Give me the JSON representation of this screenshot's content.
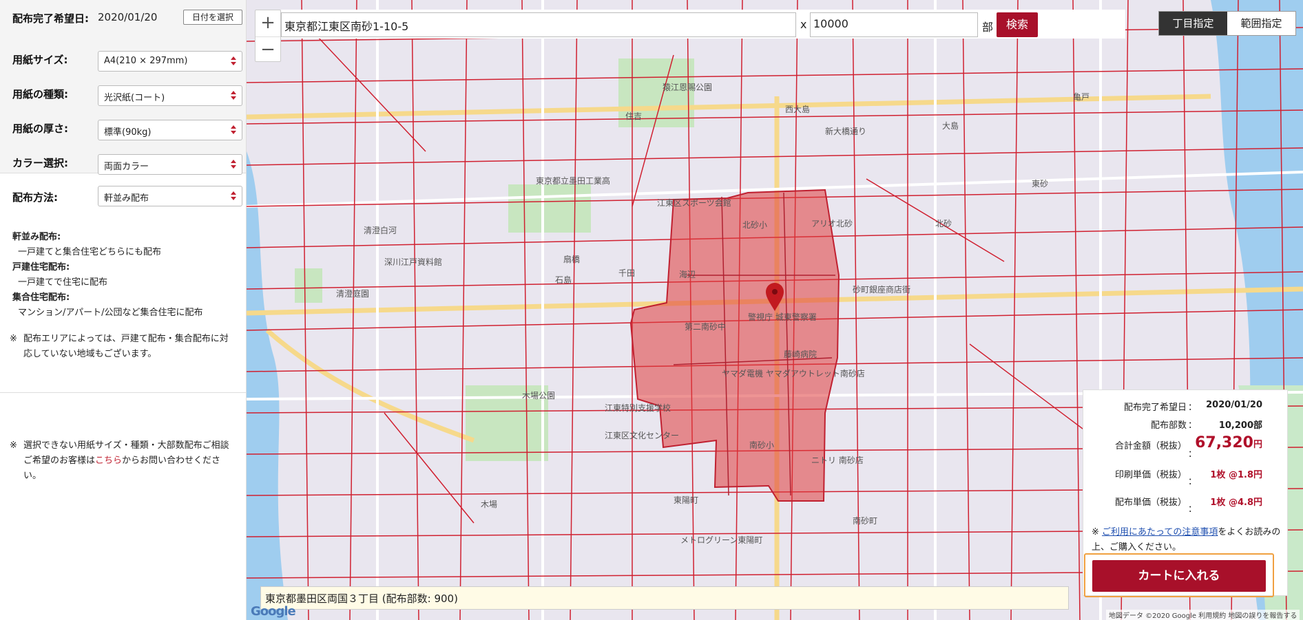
{
  "left_panel": {
    "delivery_date": {
      "label": "配布完了希望日:",
      "value": "2020/01/20",
      "button": "日付を選択"
    },
    "paper_size": {
      "label": "用紙サイズ:",
      "value": "A4(210 × 297mm)"
    },
    "paper_type": {
      "label": "用紙の種類:",
      "value": "光沢紙(コート)"
    },
    "paper_thickness": {
      "label": "用紙の厚さ:",
      "value": "標準(90kg)"
    },
    "color": {
      "label": "カラー選択:",
      "value": "両面カラー"
    },
    "method": {
      "label": "配布方法:",
      "value": "軒並み配布"
    },
    "notes": [
      {
        "title": "軒並み配布:",
        "desc": "一戸建てと集合住宅どちらにも配布"
      },
      {
        "title": "戸建住宅配布:",
        "desc": "一戸建てで住宅に配布"
      },
      {
        "title": "集合住宅配布:",
        "desc": "マンション/アパート/公団など集合住宅に配布"
      }
    ],
    "caution1": {
      "mark": "※",
      "text": "配布エリアによっては、戸建て配布・集合配布に対応していない地域もございます。"
    },
    "caution2": {
      "mark": "※",
      "text_before": "選択できない用紙サイズ・種類・大部数配布ご相談ご希望のお客様は",
      "link": "こちら",
      "text_after": "からお問い合わせください。"
    }
  },
  "map": {
    "zoom_in": "+",
    "zoom_out": "−",
    "address": "東京都江東区南砂1-10-5",
    "times": "x",
    "quantity": "10000",
    "unit": "部",
    "search_button": "検索",
    "mode_town": "丁目指定",
    "mode_range": "範囲指定",
    "area_status": "東京都墨田区両国３丁目 (配布部数: 900)",
    "google": "Google",
    "copyright": "地図データ ©2020 Google   利用規約   地図の誤りを報告する",
    "labels": [
      "北砂小",
      "アリオ北砂",
      "海辺",
      "千田",
      "石島",
      "南砂小",
      "第二南砂中",
      "藤崎病院",
      "木場公園",
      "江東区文化センター",
      "東陽町",
      "新大橋通り",
      "住吉",
      "西大島",
      "大島",
      "清澄庭園",
      "深川江戸資料館",
      "砂町銀座商店街",
      "警視庁 城東警察署",
      "ヤマダ電機 ヤマダアウトレット南砂店",
      "江東区スポーツ会館",
      "猿江恩賜公園",
      "東京都立墨田工業高",
      "清澄白河",
      "木場",
      "南砂町",
      "東砂",
      "北砂",
      "扇橋",
      "亀戸",
      "江東特別支援学校",
      "ニトリ 南砂店",
      "メトログリーン東陽町"
    ]
  },
  "summary": {
    "date": {
      "label": "配布完了希望日",
      "colon": "：",
      "value": "2020/01/20"
    },
    "copies": {
      "label": "配布部数",
      "colon": "：",
      "value": "10,200部"
    },
    "total": {
      "label": "合計金額（税抜）",
      "colon": "：",
      "value": "67,320",
      "unit": "円"
    },
    "print_unit": {
      "label": "印刷単価（税抜）",
      "colon": "：",
      "value": "1枚 @1.8円"
    },
    "dist_unit": {
      "label": "配布単価（税抜）",
      "colon": "：",
      "value": "1枚 @4.8円"
    },
    "notice_mark": "※",
    "notice_link": "ご利用にあたっての注意事項",
    "notice_text": "をよくお読みの上、ご購入ください。",
    "cart_button": "カートに入れる"
  },
  "colors": {
    "accent": "#a8102a",
    "selected_area": "#e05050",
    "cart_border": "#f0a040"
  }
}
